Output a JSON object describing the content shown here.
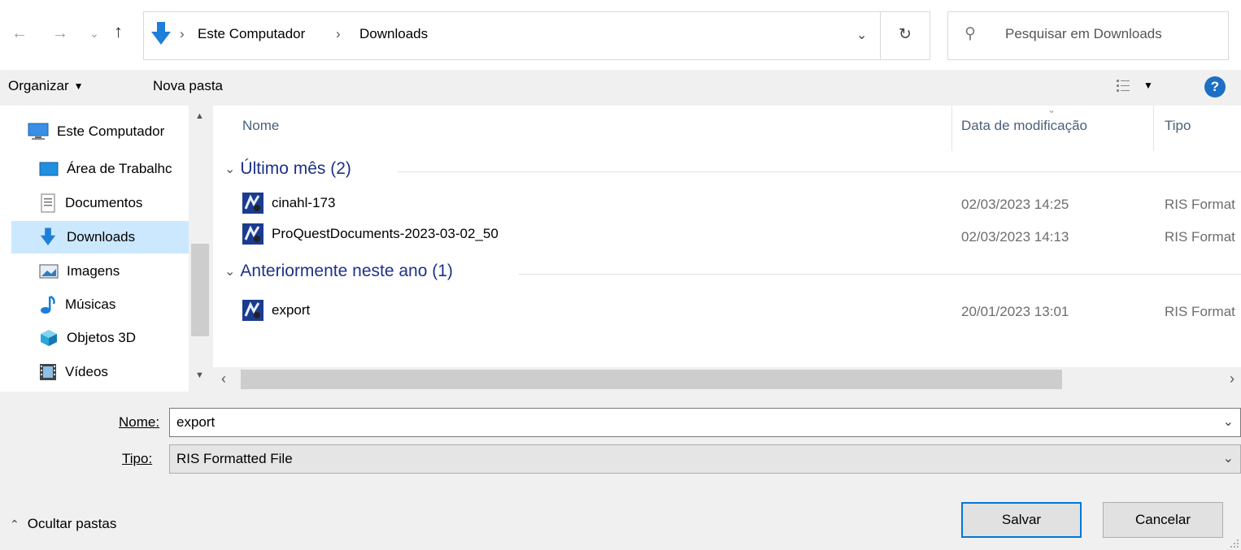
{
  "address": {
    "crumbs": [
      "Este Computador",
      "Downloads"
    ],
    "search_placeholder": "Pesquisar em Downloads"
  },
  "toolbar": {
    "organize_label": "Organizar",
    "new_folder_label": "Nova pasta",
    "help_glyph": "?"
  },
  "nav": {
    "items": [
      {
        "label": "Este Computador",
        "icon": "computer-icon"
      },
      {
        "label": "Área de Trabalhc",
        "icon": "desktop-icon"
      },
      {
        "label": "Documentos",
        "icon": "documents-icon"
      },
      {
        "label": "Downloads",
        "icon": "download-arrow-icon",
        "selected": true
      },
      {
        "label": "Imagens",
        "icon": "pictures-icon"
      },
      {
        "label": "Músicas",
        "icon": "music-note-icon"
      },
      {
        "label": "Objetos 3D",
        "icon": "3d-objects-icon"
      },
      {
        "label": "Vídeos",
        "icon": "videos-icon"
      }
    ]
  },
  "columns": {
    "name": "Nome",
    "date": "Data de modificação",
    "type": "Tipo"
  },
  "groups": [
    {
      "title": "Último mês (2)",
      "files": [
        {
          "name": "cinahl-173",
          "date": "02/03/2023 14:25",
          "type": "RIS Format"
        },
        {
          "name": "ProQuestDocuments-2023-03-02_50",
          "date": "02/03/2023 14:13",
          "type": "RIS Format"
        }
      ]
    },
    {
      "title": "Anteriormente neste ano (1)",
      "files": [
        {
          "name": "export",
          "date": "20/01/2023 13:01",
          "type": "RIS Format"
        }
      ]
    }
  ],
  "form": {
    "name_label": "Nome:",
    "name_value": "export",
    "type_label": "Tipo:",
    "type_value": "RIS Formatted File"
  },
  "footer": {
    "hide_folders_label": "Ocultar pastas",
    "save_label": "Salvar",
    "cancel_label": "Cancelar"
  },
  "colors": {
    "group_heading": "#1e3287",
    "selected_nav": "#cce8ff",
    "download_blue": "#1e7fd8"
  }
}
